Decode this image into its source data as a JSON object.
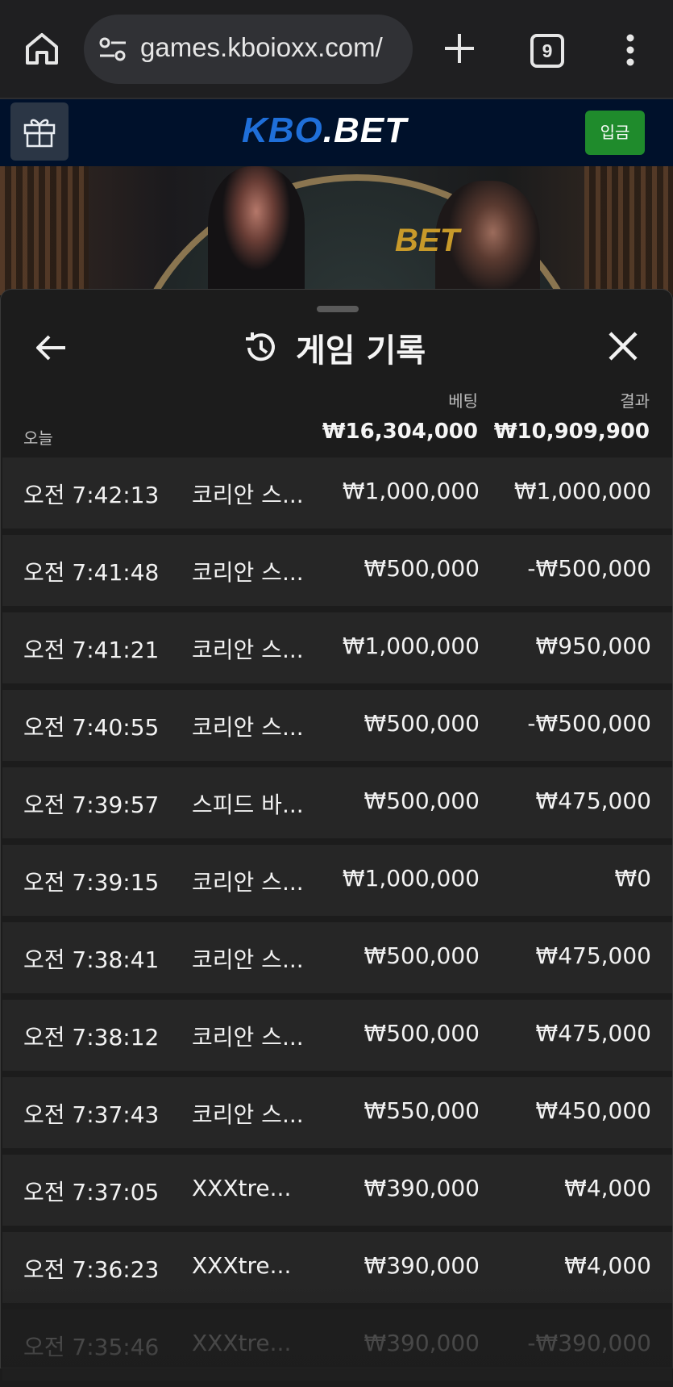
{
  "browser": {
    "url": "games.kboioxx.com/",
    "tab_count": "9",
    "icons": [
      "home-icon",
      "site-settings-icon",
      "plus-icon",
      "tab-switcher-icon",
      "more-vert-icon"
    ]
  },
  "site": {
    "logo_main": "KBO",
    "logo_dot": ".",
    "logo_bet": "BET",
    "deposit_label": "입금",
    "colors": {
      "header_bg": "#00112b",
      "logo_blue": "#1f6fd9",
      "deposit_green": "#1f8b2c"
    }
  },
  "video": {
    "sign_text": "BET"
  },
  "sheet": {
    "title": "게임 기록",
    "columns": {
      "bet": "베팅",
      "result": "결과"
    },
    "today_label": "오늘",
    "totals": {
      "bet": "₩16,304,000",
      "result": "₩10,909,900"
    },
    "rows": [
      {
        "time": "오전 7:42:13",
        "game": "코리안 스...",
        "bet": "₩1,000,000",
        "result": "₩1,000,000"
      },
      {
        "time": "오전 7:41:48",
        "game": "코리안 스...",
        "bet": "₩500,000",
        "result": "-₩500,000"
      },
      {
        "time": "오전 7:41:21",
        "game": "코리안 스...",
        "bet": "₩1,000,000",
        "result": "₩950,000"
      },
      {
        "time": "오전 7:40:55",
        "game": "코리안 스...",
        "bet": "₩500,000",
        "result": "-₩500,000"
      },
      {
        "time": "오전 7:39:57",
        "game": "스피드 바...",
        "bet": "₩500,000",
        "result": "₩475,000"
      },
      {
        "time": "오전 7:39:15",
        "game": "코리안 스...",
        "bet": "₩1,000,000",
        "result": "₩0"
      },
      {
        "time": "오전 7:38:41",
        "game": "코리안 스...",
        "bet": "₩500,000",
        "result": "₩475,000"
      },
      {
        "time": "오전 7:38:12",
        "game": "코리안 스...",
        "bet": "₩500,000",
        "result": "₩475,000"
      },
      {
        "time": "오전 7:37:43",
        "game": "코리안 스...",
        "bet": "₩550,000",
        "result": "₩450,000"
      },
      {
        "time": "오전 7:37:05",
        "game": "XXXtre...",
        "bet": "₩390,000",
        "result": "₩4,000"
      },
      {
        "time": "오전 7:36:23",
        "game": "XXXtre...",
        "bet": "₩390,000",
        "result": "₩4,000"
      },
      {
        "time": "오전 7:35:46",
        "game": "XXXtre...",
        "bet": "₩390,000",
        "result": "-₩390,000"
      }
    ]
  }
}
